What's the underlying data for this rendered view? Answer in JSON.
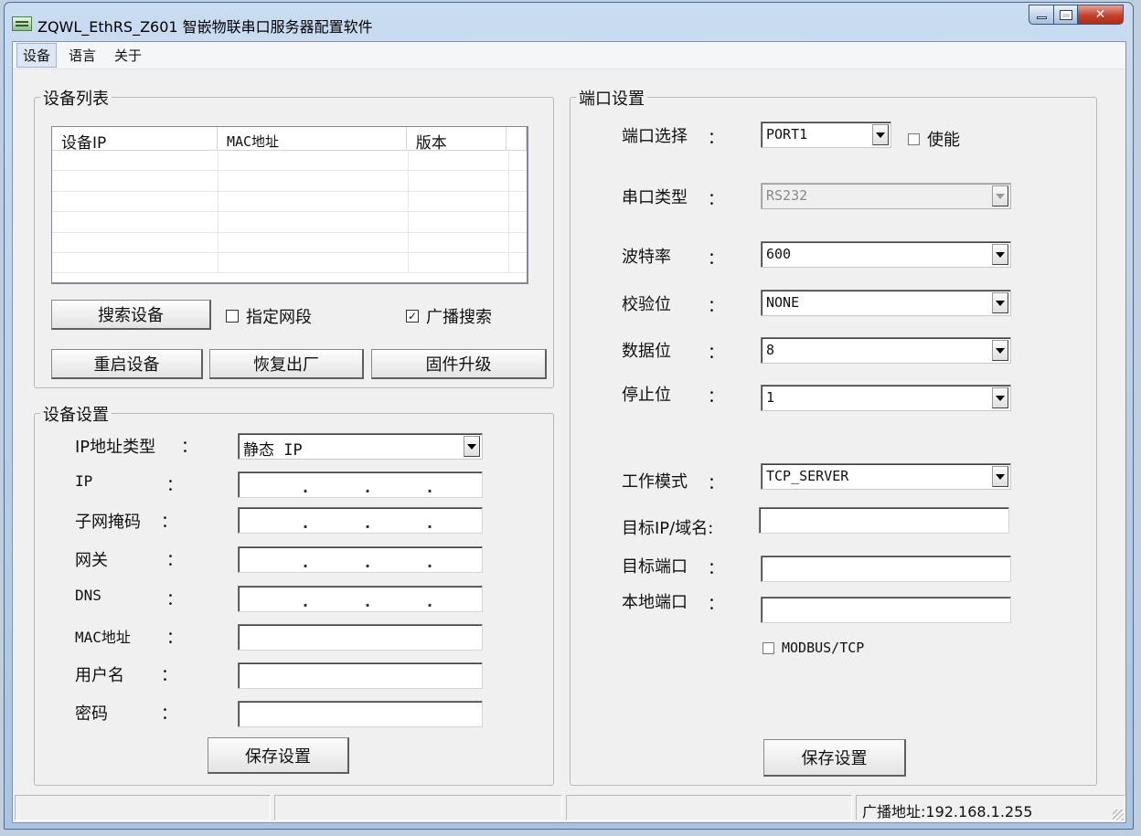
{
  "window": {
    "title": "ZQWL_EthRS_Z601 智嵌物联串口服务器配置软件",
    "close_glyph": "✕"
  },
  "menu": [
    "设备",
    "语言",
    "关于"
  ],
  "device_list": {
    "title": "设备列表",
    "columns": [
      "设备IP",
      "MAC地址",
      "版本"
    ],
    "rows": [],
    "search_button": "搜索设备",
    "specify_segment_label": "指定网段",
    "specify_segment_checked": false,
    "broadcast_label": "广播搜索",
    "broadcast_checked": true,
    "check_mark": "✓",
    "restart_button": "重启设备",
    "factory_reset_button": "恢复出厂",
    "firmware_button": "固件升级"
  },
  "device_settings": {
    "title": "设备设置",
    "colon": "：",
    "ip_type_label": "IP地址类型",
    "ip_type_value": "静态 IP",
    "ip_label": "IP",
    "subnet_label": "子网掩码",
    "gateway_label": "网关",
    "dns_label": "DNS",
    "mac_label": "MAC地址",
    "username_label": "用户名",
    "password_label": "密码",
    "ip_dot": ".",
    "save_button": "保存设置"
  },
  "port_settings": {
    "title": "端口设置",
    "colon": "：",
    "port_select_label": "端口选择",
    "port_value": "PORT1",
    "enable_label": "使能",
    "enable_checked": false,
    "serial_type_label": "串口类型",
    "serial_type_value": "RS232",
    "baud_label": "波特率",
    "baud_value": "600",
    "parity_label": "校验位",
    "parity_value": "NONE",
    "data_bits_label": "数据位",
    "data_bits_value": "8",
    "stop_bits_label": "停止位",
    "stop_bits_value": "1",
    "work_mode_label": "工作模式",
    "work_mode_value": "TCP_SERVER",
    "target_ip_label": "目标IP/域名:",
    "target_port_label": "目标端口",
    "local_port_label": "本地端口",
    "modbus_label": "MODBUS/TCP",
    "modbus_checked": false,
    "save_button": "保存设置"
  },
  "status_bar": {
    "broadcast_address": "广播地址:192.168.1.255"
  }
}
